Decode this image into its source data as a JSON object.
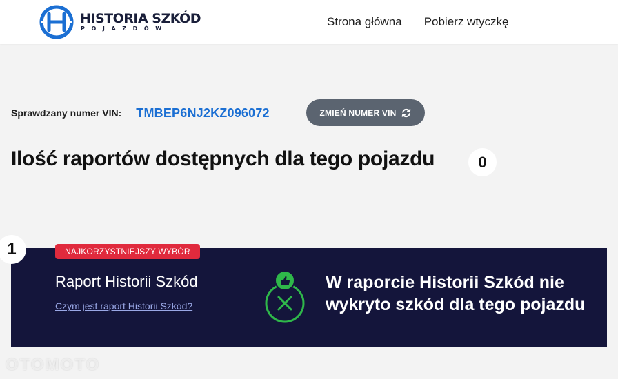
{
  "header": {
    "logo": {
      "title": "HISTORIA SZKÓD",
      "subtitle": "POJAZDÓW",
      "icon": "hs-logo-icon",
      "color": "#1b6fd3"
    },
    "nav": [
      {
        "label": "Strona główna"
      },
      {
        "label": "Pobierz wtyczkę"
      }
    ]
  },
  "vin": {
    "label": "Sprawdzany numer VIN:",
    "value": "TMBEP6NJ2KZ096072",
    "change_button": "ZMIEŃ NUMER VIN",
    "change_icon": "refresh-icon"
  },
  "reports": {
    "title": "Ilość raportów dostępnych dla tego pojazdu",
    "count": "0"
  },
  "card": {
    "number": "1",
    "badge": "NAJKORZYSTNIEJSZY WYBÓR",
    "title": "Raport Historii Szkód",
    "link": "Czym jest raport Historii Szkód?",
    "result": "W raporcie Historii Szkód nie wykryto szkód dla tego pojazdu",
    "status_icon": "no-damage-icon",
    "accent": "#2fb84a"
  },
  "watermark": "OTOMOTO"
}
